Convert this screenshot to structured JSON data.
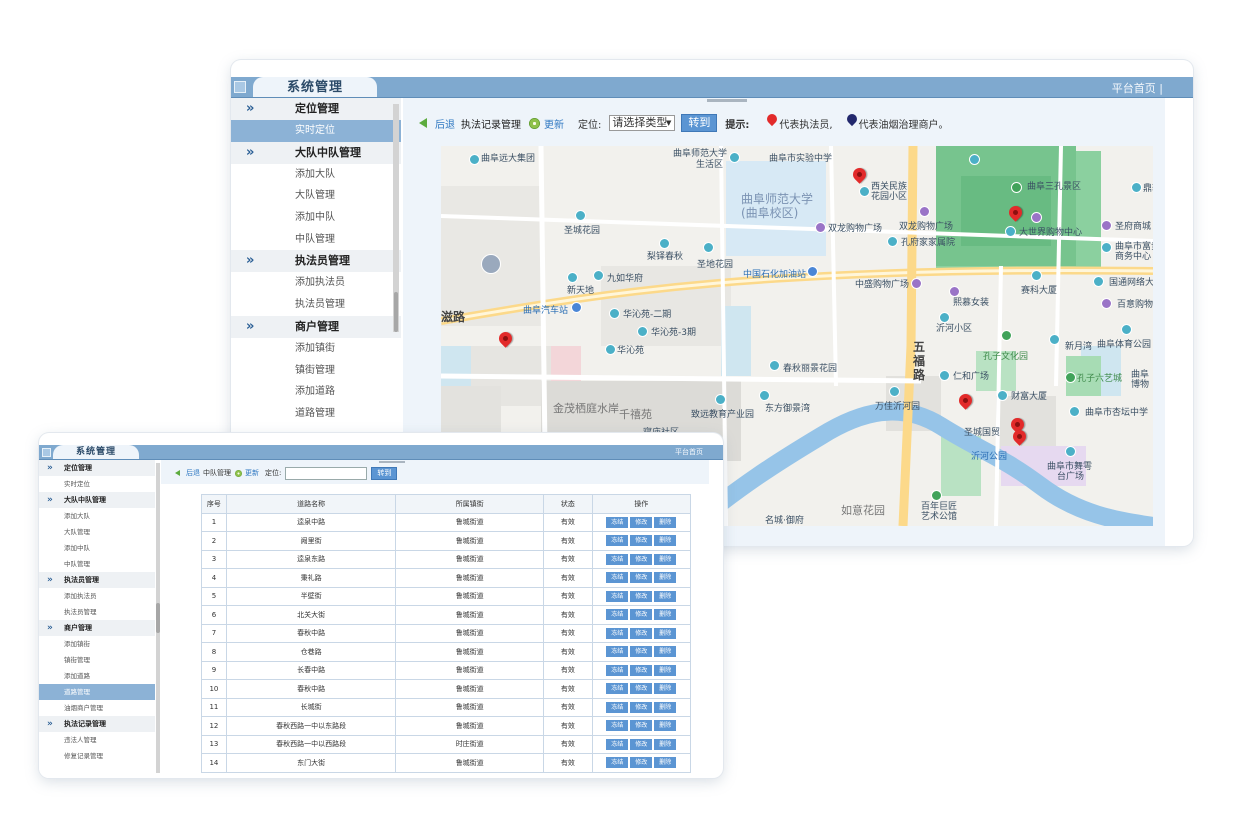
{
  "window1": {
    "tab_title": "系统管理",
    "home_link": "平台首页 |",
    "sidebar": [
      {
        "type": "section",
        "label": "定位管理"
      },
      {
        "type": "item",
        "label": "实时定位",
        "active": true
      },
      {
        "type": "section",
        "label": "大队中队管理"
      },
      {
        "type": "item",
        "label": "添加大队"
      },
      {
        "type": "item",
        "label": "大队管理"
      },
      {
        "type": "item",
        "label": "添加中队"
      },
      {
        "type": "item",
        "label": "中队管理"
      },
      {
        "type": "section",
        "label": "执法员管理"
      },
      {
        "type": "item",
        "label": "添加执法员"
      },
      {
        "type": "item",
        "label": "执法员管理"
      },
      {
        "type": "section",
        "label": "商户管理"
      },
      {
        "type": "item",
        "label": "添加镇街"
      },
      {
        "type": "item",
        "label": "镇街管理"
      },
      {
        "type": "item",
        "label": "添加道路"
      },
      {
        "type": "item",
        "label": "道路管理"
      }
    ],
    "toolbar": {
      "back": "后退",
      "breadcrumb": "执法记录管理",
      "refresh": "更新",
      "locate_label": "定位:",
      "select_value": "请选择类型",
      "go_button": "转到",
      "hint_label": "提示:",
      "hint_red": "代表执法员,",
      "hint_blue": "代表油烟治理商户。"
    },
    "map_labels": {
      "l1": "曲阜远大集团",
      "l2": "曲阜师范大学",
      "l3": "生活区",
      "l4": "曲阜市实验中学",
      "l5": "曲阜师范大学",
      "l6": "(曲阜校区)",
      "l7": "西关民族",
      "l8": "花园小区",
      "l9": "曲阜三孔景区",
      "l10": "鼎轩",
      "l11": "圣城花园",
      "l12": "双龙购物广场",
      "l13": "双龙购物广场",
      "l14": "大世界购物中心",
      "l15": "圣府商城",
      "l16": "梨铎春秋",
      "l17": "圣地花园",
      "l18": "孔府家家属院",
      "l19": "曲阜市富贵",
      "l20": "商务中心",
      "l21": "新天地",
      "l22": "九如华府",
      "l23": "中国石化加油站",
      "l24": "中盛购物广场",
      "l25": "赛科大厦",
      "l26": "国通网络大科",
      "l27": "百意购物中心",
      "l28": "曲阜汽车站",
      "l29": "华沁苑-二期",
      "l30": "熙慕女装",
      "l31": "华沁苑-3期",
      "l32": "沂河小区",
      "l33": "新月湾",
      "l34": "曲阜体育公园",
      "l35": "华沁苑",
      "l36": "五",
      "l37": "福",
      "l38": "路",
      "l39": "孔子文化园",
      "l40": "春秋丽景花园",
      "l41": "仁和广场",
      "l42": "孔子六艺城",
      "l43": "金茂栖庭水岸",
      "l44": "千禧苑",
      "l45": "东方御景湾",
      "l46": "万佳沂河园",
      "l47": "财富大厦",
      "l48": "曲阜市杏坛中学",
      "l49": "致远教育产业园",
      "l50": "圣城国贸",
      "l51": "沂河公园",
      "l52": "曲阜市舞雩",
      "l53": "台广场",
      "l54": "寝庙社区",
      "l55": "如意花园",
      "l56": "百年巨匠",
      "l57": "艺术公馆",
      "l58": "名城·御府",
      "l59": "滋路",
      "l60": "曲阜",
      "l61": "博物"
    }
  },
  "window2": {
    "tab_title": "系统管理",
    "home_link": "平台首页",
    "sidebar": [
      {
        "type": "section",
        "label": "定位管理"
      },
      {
        "type": "item",
        "label": "实时定位"
      },
      {
        "type": "section",
        "label": "大队中队管理"
      },
      {
        "type": "item",
        "label": "添加大队"
      },
      {
        "type": "item",
        "label": "大队管理"
      },
      {
        "type": "item",
        "label": "添加中队"
      },
      {
        "type": "item",
        "label": "中队管理"
      },
      {
        "type": "section",
        "label": "执法员管理"
      },
      {
        "type": "item",
        "label": "添加执法员"
      },
      {
        "type": "item",
        "label": "执法员管理"
      },
      {
        "type": "section",
        "label": "商户管理"
      },
      {
        "type": "item",
        "label": "添加镇街"
      },
      {
        "type": "item",
        "label": "镇街管理"
      },
      {
        "type": "item",
        "label": "添加道路"
      },
      {
        "type": "item",
        "label": "道路管理",
        "active": true
      },
      {
        "type": "item",
        "label": "油烟商户管理"
      },
      {
        "type": "section",
        "label": "执法记录管理"
      },
      {
        "type": "item",
        "label": "违法人管理"
      },
      {
        "type": "item",
        "label": "修复记录管理"
      }
    ],
    "toolbar": {
      "back": "后退",
      "breadcrumb": "中队管理",
      "refresh": "更新",
      "locate_label": "定位:",
      "go_button": "转到"
    },
    "table": {
      "headers": [
        "序号",
        "道路名称",
        "所属镇街",
        "状态",
        "操作"
      ],
      "op_labels": [
        "冻结",
        "修改",
        "删除"
      ],
      "rows": [
        [
          "1",
          "逵泉中路",
          "鲁城街道",
          "有效"
        ],
        [
          "2",
          "阙里街",
          "鲁城街道",
          "有效"
        ],
        [
          "3",
          "逵泉东路",
          "鲁城街道",
          "有效"
        ],
        [
          "4",
          "秉礼路",
          "鲁城街道",
          "有效"
        ],
        [
          "5",
          "半壁街",
          "鲁城街道",
          "有效"
        ],
        [
          "6",
          "北关大街",
          "鲁城街道",
          "有效"
        ],
        [
          "7",
          "春秋中路",
          "鲁城街道",
          "有效"
        ],
        [
          "8",
          "仓巷路",
          "鲁城街道",
          "有效"
        ],
        [
          "9",
          "长春中路",
          "鲁城街道",
          "有效"
        ],
        [
          "10",
          "春秋中路",
          "鲁城街道",
          "有效"
        ],
        [
          "11",
          "长城街",
          "鲁城街道",
          "有效"
        ],
        [
          "12",
          "春秋西路一中以东路段",
          "鲁城街道",
          "有效"
        ],
        [
          "13",
          "春秋西路一中以西路段",
          "时庄街道",
          "有效"
        ],
        [
          "14",
          "东门大街",
          "鲁城街道",
          "有效"
        ]
      ]
    }
  }
}
